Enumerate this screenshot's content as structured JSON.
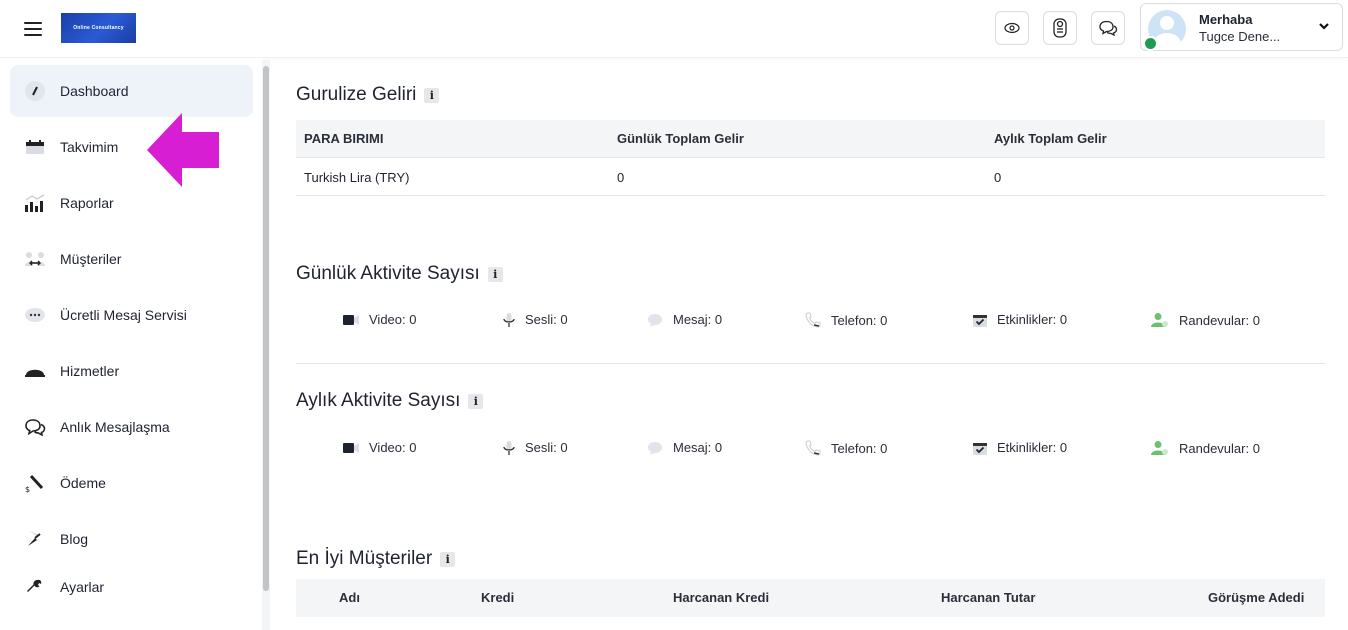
{
  "header": {
    "logo_text": "Online Consultancy",
    "greeting": "Merhaba",
    "username": "Tugce Dene...",
    "icons": [
      "eye-icon",
      "toggle-icon",
      "chat-icon",
      "chevron-down-icon"
    ]
  },
  "sidebar": {
    "items": [
      {
        "label": "Dashboard",
        "icon": "gauge-icon",
        "active": true
      },
      {
        "label": "Takvimim",
        "icon": "calendar-icon"
      },
      {
        "label": "Raporlar",
        "icon": "bar-chart-icon"
      },
      {
        "label": "Müşteriler",
        "icon": "users-icon"
      },
      {
        "label": "Ücretli Mesaj Servisi",
        "icon": "message-dots-icon"
      },
      {
        "label": "Hizmetler",
        "icon": "dome-icon"
      },
      {
        "label": "Anlık Mesajlaşma",
        "icon": "chat-bubbles-icon"
      },
      {
        "label": "Ödeme",
        "icon": "payment-icon"
      },
      {
        "label": "Blog",
        "icon": "pen-icon"
      },
      {
        "label": "Ayarlar",
        "icon": "wrench-icon"
      }
    ]
  },
  "income": {
    "title": "Gurulize Geliri",
    "columns": [
      "PARA BIRIMI",
      "Günlük Toplam Gelir",
      "Aylık Toplam Gelir"
    ],
    "rows": [
      [
        "Turkish Lira (TRY)",
        "0",
        "0"
      ]
    ]
  },
  "daily_activity": {
    "title": "Günlük Aktivite Sayısı",
    "items": [
      "Video: 0",
      "Sesli: 0",
      "Mesaj: 0",
      "Telefon: 0",
      "Etkinlikler: 0",
      "Randevular: 0"
    ]
  },
  "monthly_activity": {
    "title": "Aylık Aktivite Sayısı",
    "items": [
      "Video: 0",
      "Sesli: 0",
      "Mesaj: 0",
      "Telefon: 0",
      "Etkinlikler: 0",
      "Randevular: 0"
    ]
  },
  "top_customers": {
    "title": "En İyi Müşteriler",
    "columns": [
      "Adı",
      "Kredi",
      "Harcanan Kredi",
      "Harcanan Tutar",
      "Görüşme Adedi"
    ]
  },
  "info_symbol": "i",
  "colors": {
    "active_bg": "#eef3fa",
    "online": "#1f9a53",
    "annotation_arrow": "#d81ed2",
    "randevu_icon": "#6fbf73"
  }
}
